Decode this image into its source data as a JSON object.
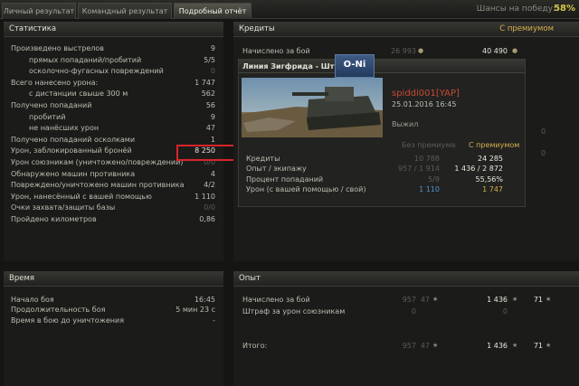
{
  "tabs": [
    "Личный результат",
    "Командный результат",
    "Подробный отчёт"
  ],
  "win_chance": {
    "label": "Шансы на победу:",
    "value": "58%"
  },
  "stats": {
    "title": "Статистика",
    "rows": [
      {
        "label": "Произведено выстрелов",
        "value": "9"
      },
      {
        "label": "прямых попаданий/пробитий",
        "value": "5/5"
      },
      {
        "label": "осколочно-фугасных повреждений",
        "value": "0"
      },
      {
        "label": "Всего нанесено урона:",
        "value": "1 747"
      },
      {
        "label": "с дистанции свыше 300 м",
        "value": "562"
      },
      {
        "label": "Получено попаданий",
        "value": "56"
      },
      {
        "label": "пробитий",
        "value": "9"
      },
      {
        "label": "не нанёсших урон",
        "value": "47"
      },
      {
        "label": "Получено попаданий осколками",
        "value": "1"
      },
      {
        "label": "Урон, заблокированный бронёй",
        "value": "8 250"
      },
      {
        "label": "Урон союзникам (уничтожено/повреждений)",
        "value": "0/0"
      },
      {
        "label": "Обнаружено машин противника",
        "value": "4"
      },
      {
        "label": "Повреждено/уничтожено машин противника",
        "value": "4/2"
      },
      {
        "label": "Урон, нанесённый с вашей помощью",
        "value": "1 110"
      },
      {
        "label": "Очки захвата/защиты базы",
        "value": "0/0"
      },
      {
        "label": "Пройдено километров",
        "value": "0,86"
      }
    ]
  },
  "credits": {
    "title": "Кредиты",
    "premium_label": "С премиумом",
    "earned_label": "Начислено за бой",
    "earned_base": "26 993",
    "earned_premium": "40 490"
  },
  "report": {
    "map": "Линия Зигфрида - Штурм",
    "tank": "O-Ni",
    "player": "spiddi001[YAP]",
    "date": "25.01.2016 16:45",
    "status": "Выжил",
    "col_base": "Без премиума",
    "col_premium": "С премиумом",
    "rows": [
      {
        "label": "Кредиты",
        "base": "10 788",
        "premium": "24 285"
      },
      {
        "label": "Опыт / экипажу",
        "base": "957 / 1 914",
        "premium": "1 436 / 2 872"
      },
      {
        "label": "Процент попаданий",
        "base": "5/9",
        "premium": "55,56%"
      },
      {
        "label": "Урон (с вашей помощью / свой)",
        "base": "1 110",
        "premium": "1 747"
      }
    ],
    "right_zero_1": "0",
    "right_zero_2": "0"
  },
  "time": {
    "title": "Время",
    "rows": [
      {
        "label": "Начало боя",
        "value": "16:45"
      },
      {
        "label": "Продолжительность боя",
        "value": "5 мин 23 с"
      },
      {
        "label": "Время в бою до уничтожения",
        "value": "-"
      }
    ]
  },
  "xp": {
    "title": "Опыт",
    "earned_label": "Начислено за бой",
    "earned": [
      "957",
      "47",
      "1 436",
      "71"
    ],
    "penalty_label": "Штраф за урон союзникам",
    "penalty": [
      "0",
      "0"
    ],
    "total_label": "Итого:",
    "total": [
      "957",
      "47",
      "1 436",
      "71"
    ]
  }
}
